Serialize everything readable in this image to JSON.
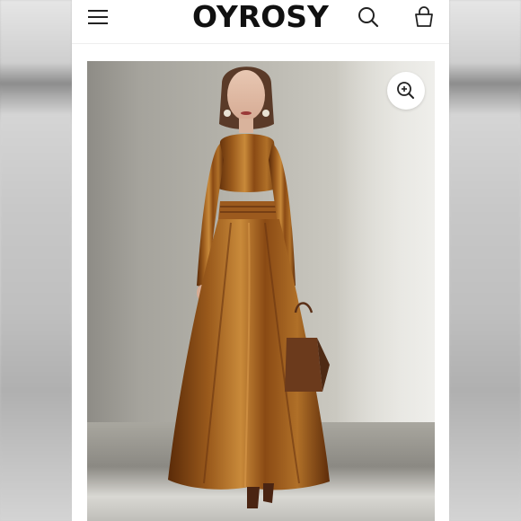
{
  "header": {
    "brand": "OYROSY",
    "menu_icon": "hamburger-menu-icon",
    "search_icon": "search-icon",
    "cart_icon": "shopping-bag-icon"
  },
  "product_image": {
    "zoom_icon": "zoom-in-icon"
  },
  "colors": {
    "header_bg": "#ffffff",
    "brand_text": "#111111",
    "dress": "#8a4a14",
    "bag": "#6b3a1c"
  }
}
